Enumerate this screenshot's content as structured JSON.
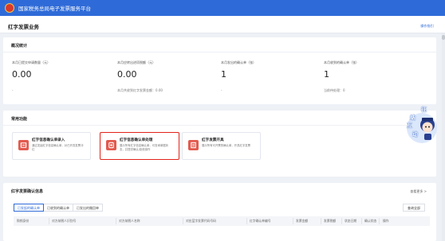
{
  "header": {
    "title": "国家税务总局电子发票服务平台"
  },
  "page": {
    "title": "红字发票业务",
    "guide_link": "操作指引"
  },
  "overview": {
    "title": "概况统计",
    "stats": [
      {
        "label": "本月已提交申请数量（元）",
        "value": "0.00",
        "sub": "-"
      },
      {
        "label": "本月应转出进项税额（元）",
        "value": "0.00",
        "sub": "本月共收到红字发票金额：0.00"
      },
      {
        "label": "本月发出的确认单（张）",
        "value": "1",
        "sub": "-"
      },
      {
        "label": "本月收到的确认单（张）",
        "value": "1",
        "sub": "当前待处理：0"
      }
    ]
  },
  "functions": {
    "title": "常用功能",
    "items": [
      {
        "name": "红字信息确认单录入",
        "desc": "通过发起红字信息确认单，对已开具发票冲红"
      },
      {
        "name": "红字信息确认单处理",
        "desc": "展示所有红字信息确认单，可查询单据状态，并提供确认/拒绝操作"
      },
      {
        "name": "红字发票开具",
        "desc": "展示所有可开票的确认单，开具红字发票"
      }
    ]
  },
  "confirmation": {
    "title": "红字发票确认信息",
    "more_link": "查看更多 >",
    "tabs": [
      "已发起的确认单",
      "已收到的确认单",
      "已发出的撤回单"
    ],
    "query_button": "查询全部",
    "columns": [
      "购销身份",
      "对方纳税人识别号",
      "对方纳税人名称",
      "对应蓝字发票代码号码",
      "红字确认单编号",
      "发票金额",
      "发票税额",
      "状态日期",
      "确认状态",
      "操作"
    ]
  },
  "mascot": {
    "labels": [
      "征",
      "纳",
      "互",
      "动"
    ]
  },
  "colors": {
    "brand_blue": "#2f6bd8",
    "highlight_red": "#e2231a",
    "icon_red": "#e25a4e"
  },
  "icons": {
    "feature": "document-icon"
  }
}
